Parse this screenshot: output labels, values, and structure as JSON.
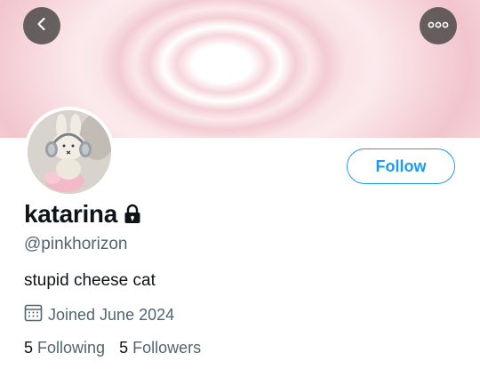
{
  "profile": {
    "display_name": "katarina",
    "handle": "@pinkhorizon",
    "bio": "stupid cheese cat",
    "joined": "Joined June 2024",
    "following_count": "5",
    "following_label": "Following",
    "followers_count": "5",
    "followers_label": "Followers",
    "protected": true
  },
  "actions": {
    "follow_label": "Follow"
  },
  "icons": {
    "back": "back-arrow-icon",
    "more": "more-options-icon",
    "lock": "lock-icon",
    "calendar": "calendar-icon"
  },
  "colors": {
    "accent": "#1d9bf0",
    "secondary_text": "#536471",
    "primary_text": "#0f1419",
    "banner_pink": "#f2c5cd"
  }
}
